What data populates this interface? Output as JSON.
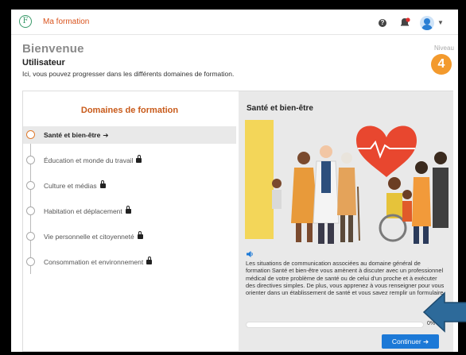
{
  "app": {
    "brand": "Ma formation",
    "logo_letter": "F"
  },
  "topbar": {
    "help": "?"
  },
  "header": {
    "welcome": "Bienvenue",
    "user": "Utilisateur",
    "intro": "Ici, vous pouvez progresser dans les différents domaines de formation.",
    "level_label": "Niveau",
    "level_value": "4"
  },
  "domains": {
    "title": "Domaines de formation",
    "items": [
      {
        "label": "Santé et bien-être",
        "active": true,
        "locked": false
      },
      {
        "label": "Éducation et monde du travail",
        "active": false,
        "locked": true
      },
      {
        "label": "Culture et médias",
        "active": false,
        "locked": true
      },
      {
        "label": "Habitation et déplacement",
        "active": false,
        "locked": true
      },
      {
        "label": "Vie personnelle et citoyenneté",
        "active": false,
        "locked": true
      },
      {
        "label": "Consommation et environnement",
        "active": false,
        "locked": true
      }
    ]
  },
  "detail": {
    "title": "Santé et bien-être",
    "description": "Les situations de communication associées au domaine général de formation Santé et bien-être vous amènent à discuter avec un professionnel médical de votre problème de santé ou de celui d'un proche et à exécuter des directives simples. De plus, vous apprenez à vous renseigner pour vous orienter dans un établissement de santé et vous savez remplir un formulaire.",
    "progress": 0,
    "progress_label": "0%",
    "continue_label": "Continuer ➔"
  },
  "colors": {
    "accent": "#1c79d7",
    "brand": "#d9541e",
    "level": "#f39a2d",
    "arrow": "#2d6a9a"
  }
}
